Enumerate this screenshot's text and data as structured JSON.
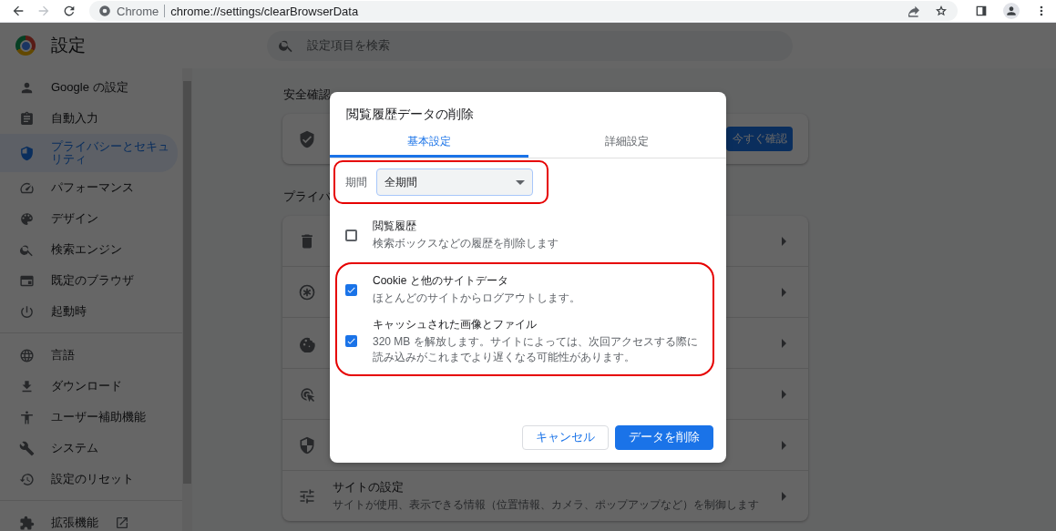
{
  "browser": {
    "nav": [
      {
        "kind": "back",
        "disabled": false
      },
      {
        "kind": "forward",
        "disabled": true
      },
      {
        "kind": "reload",
        "disabled": false
      }
    ],
    "omnibox": {
      "site_label": "Chrome",
      "url": "chrome://settings/clearBrowserData"
    }
  },
  "settings": {
    "title": "設定",
    "search": {
      "placeholder": "設定項目を検索"
    }
  },
  "sidebar": {
    "groups": [
      {
        "items": [
          {
            "label": "Google の設定",
            "selected": false
          },
          {
            "label": "自動入力",
            "selected": false
          },
          {
            "label": "プライバシーとセキュリティ",
            "selected": true
          },
          {
            "label": "パフォーマンス",
            "selected": false
          },
          {
            "label": "デザイン",
            "selected": false
          },
          {
            "label": "検索エンジン",
            "selected": false
          },
          {
            "label": "既定のブラウザ",
            "selected": false
          },
          {
            "label": "起動時",
            "selected": false
          }
        ]
      },
      {
        "items": [
          {
            "label": "言語",
            "selected": false
          },
          {
            "label": "ダウンロード",
            "selected": false
          },
          {
            "label": "ユーザー補助機能",
            "selected": false
          },
          {
            "label": "システム",
            "selected": false
          },
          {
            "label": "設定のリセット",
            "selected": false
          }
        ]
      },
      {
        "items": [
          {
            "label": "拡張機能",
            "selected": false
          }
        ]
      }
    ]
  },
  "main": {
    "safety": {
      "heading": "安全確認",
      "button": "今すぐ確認"
    },
    "privacy": {
      "heading": "プライバ",
      "rows": [
        {
          "kind": "covered"
        },
        {
          "kind": "covered"
        },
        {
          "kind": "covered"
        },
        {
          "kind": "covered"
        },
        {
          "kind": "covered"
        },
        {
          "kind": "text",
          "title": "サイトの設定",
          "description": "サイトが使用、表示できる情報（位置情報、カメラ、ポップアップなど）を制御します"
        }
      ]
    }
  },
  "dialog": {
    "title": "閲覧履歴データの削除",
    "tabs": [
      {
        "label": "基本設定",
        "selected": true
      },
      {
        "label": "詳細設定",
        "selected": false
      }
    ],
    "period": {
      "label": "期間",
      "value": "全期間",
      "highlighted": true
    },
    "option_groups": [
      {
        "highlighted": false,
        "options": [
          {
            "title": "閲覧履歴",
            "description": "検索ボックスなどの履歴を削除します",
            "checked": false
          }
        ]
      },
      {
        "highlighted": true,
        "options": [
          {
            "title": "Cookie と他のサイトデータ",
            "description": "ほとんどのサイトからログアウトします。",
            "checked": true
          },
          {
            "title": "キャッシュされた画像とファイル",
            "description": "320 MB を解放します。サイトによっては、次回アクセスする際に読み込みがこれまでより遅くなる可能性があります。",
            "checked": true
          }
        ]
      }
    ],
    "buttons": [
      {
        "label": "キャンセル",
        "kind": "secondary"
      },
      {
        "label": "データを削除",
        "kind": "primary"
      }
    ]
  }
}
